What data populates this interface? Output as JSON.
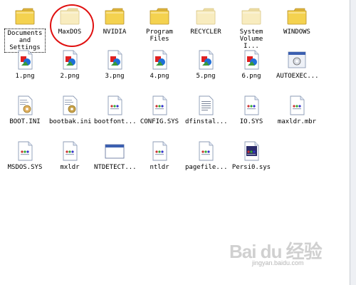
{
  "window": {
    "title": ""
  },
  "items": [
    {
      "label": "Documents\nand\nSettings",
      "type": "folder",
      "icon": "folder-icon",
      "faded": false,
      "selected": true
    },
    {
      "label": "MaxDOS",
      "type": "folder",
      "icon": "folder-icon",
      "faded": true,
      "selected": false
    },
    {
      "label": "NVIDIA",
      "type": "folder",
      "icon": "folder-icon",
      "faded": false,
      "selected": false
    },
    {
      "label": "Program\nFiles",
      "type": "folder",
      "icon": "folder-icon",
      "faded": false,
      "selected": false
    },
    {
      "label": "RECYCLER",
      "type": "folder",
      "icon": "folder-icon",
      "faded": true,
      "selected": false
    },
    {
      "label": "System\nVolume I...",
      "type": "folder",
      "icon": "folder-icon",
      "faded": true,
      "selected": false
    },
    {
      "label": "WINDOWS",
      "type": "folder",
      "icon": "folder-icon",
      "faded": false,
      "selected": false
    },
    {
      "label": "1.png",
      "type": "png",
      "icon": "image-file-icon",
      "faded": false,
      "selected": false
    },
    {
      "label": "2.png",
      "type": "png",
      "icon": "image-file-icon",
      "faded": false,
      "selected": false
    },
    {
      "label": "3.png",
      "type": "png",
      "icon": "image-file-icon",
      "faded": false,
      "selected": false
    },
    {
      "label": "4.png",
      "type": "png",
      "icon": "image-file-icon",
      "faded": false,
      "selected": false
    },
    {
      "label": "5.png",
      "type": "png",
      "icon": "image-file-icon",
      "faded": false,
      "selected": false
    },
    {
      "label": "6.png",
      "type": "png",
      "icon": "image-file-icon",
      "faded": false,
      "selected": false
    },
    {
      "label": "AUTOEXEC...",
      "type": "exe",
      "icon": "executable-icon",
      "faded": false,
      "selected": false
    },
    {
      "label": "BOOT.INI",
      "type": "ini",
      "icon": "config-file-icon",
      "faded": false,
      "selected": false
    },
    {
      "label": "bootbak.ini",
      "type": "ini",
      "icon": "config-file-icon",
      "faded": false,
      "selected": false
    },
    {
      "label": "bootfont...",
      "type": "sys",
      "icon": "system-file-icon",
      "faded": false,
      "selected": false
    },
    {
      "label": "CONFIG.SYS",
      "type": "sys",
      "icon": "system-file-icon",
      "faded": false,
      "selected": false
    },
    {
      "label": "dfinstal...",
      "type": "txt",
      "icon": "text-file-icon",
      "faded": false,
      "selected": false
    },
    {
      "label": "IO.SYS",
      "type": "sys",
      "icon": "system-file-icon",
      "faded": false,
      "selected": false
    },
    {
      "label": "maxldr.mbr",
      "type": "sys",
      "icon": "system-file-icon",
      "faded": false,
      "selected": false
    },
    {
      "label": "MSDOS.SYS",
      "type": "sys",
      "icon": "system-file-icon",
      "faded": false,
      "selected": false
    },
    {
      "label": "mxldr",
      "type": "sys",
      "icon": "system-file-icon",
      "faded": false,
      "selected": false
    },
    {
      "label": "NTDETECT...",
      "type": "exe",
      "icon": "application-window-icon",
      "faded": false,
      "selected": false
    },
    {
      "label": "ntldr",
      "type": "sys",
      "icon": "system-file-icon",
      "faded": false,
      "selected": false
    },
    {
      "label": "pagefile...",
      "type": "sys",
      "icon": "system-file-icon",
      "faded": false,
      "selected": false
    },
    {
      "label": "Persi0.sys",
      "type": "sys-dark",
      "icon": "system-file-icon",
      "faded": false,
      "selected": false
    }
  ],
  "colors": {
    "annotation_circle": "#e01010",
    "folder": "#f4d24f",
    "folder_faded": "#f7e9b8",
    "background": "#ffffff"
  },
  "watermark": {
    "main": "Bai du 经验",
    "sub": "jingyan.baidu.com"
  }
}
